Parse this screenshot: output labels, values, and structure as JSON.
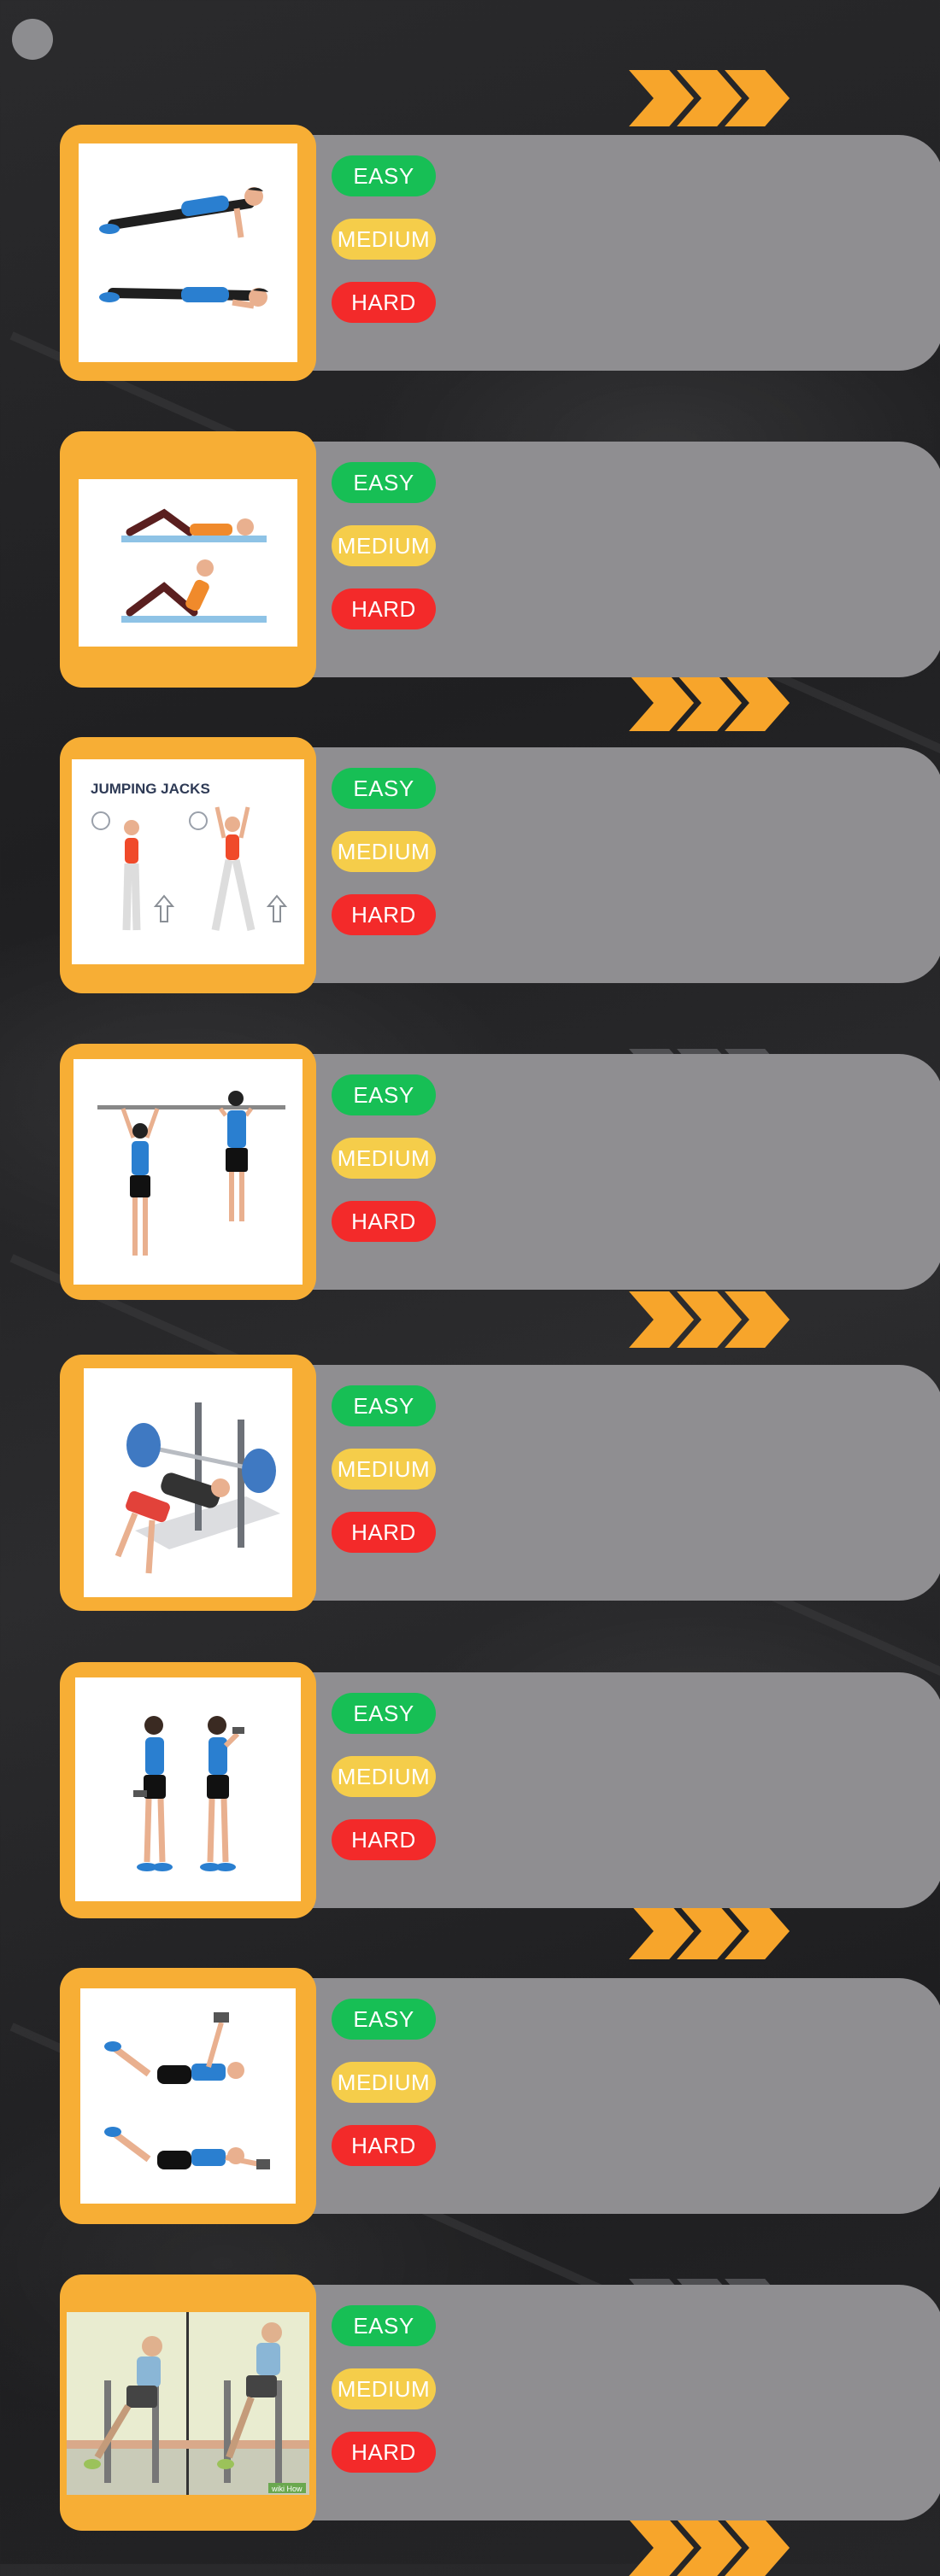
{
  "ui": {
    "accent": "#f7a52b",
    "panel_color": "#8f8e91",
    "easy_color": "#17bf55",
    "medium_color": "#f5cd4a",
    "hard_color": "#f32a2a"
  },
  "menu": {
    "icon": "circle-menu-icon"
  },
  "exercises": [
    {
      "id": "pushups",
      "levels": {
        "easy": "EASY",
        "medium": "MEDIUM",
        "hard": "HARD"
      }
    },
    {
      "id": "situps",
      "levels": {
        "easy": "EASY",
        "medium": "MEDIUM",
        "hard": "HARD"
      }
    },
    {
      "id": "jumping-jacks",
      "illustration_title": "JUMPING JACKS",
      "levels": {
        "easy": "EASY",
        "medium": "MEDIUM",
        "hard": "HARD"
      }
    },
    {
      "id": "pullups",
      "levels": {
        "easy": "EASY",
        "medium": "MEDIUM",
        "hard": "HARD"
      }
    },
    {
      "id": "bench-press",
      "levels": {
        "easy": "EASY",
        "medium": "MEDIUM",
        "hard": "HARD"
      }
    },
    {
      "id": "bicep-curls",
      "levels": {
        "easy": "EASY",
        "medium": "MEDIUM",
        "hard": "HARD"
      }
    },
    {
      "id": "dumbbell-pullover",
      "levels": {
        "easy": "EASY",
        "medium": "MEDIUM",
        "hard": "HARD"
      }
    },
    {
      "id": "dips",
      "illustration_watermark": "wiki How",
      "levels": {
        "easy": "EASY",
        "medium": "MEDIUM",
        "hard": "HARD"
      }
    }
  ]
}
